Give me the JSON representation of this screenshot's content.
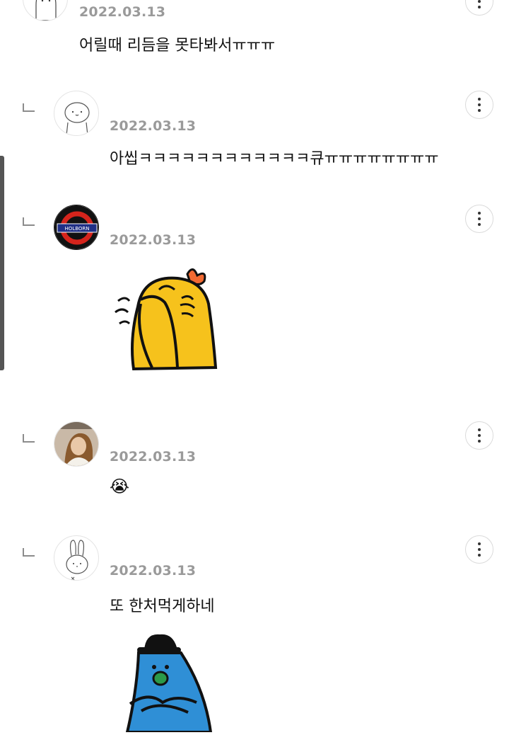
{
  "comments": [
    {
      "date": "2022.03.13",
      "text": "어릴때 리듬을 못타봐서ㅠㅠㅠ"
    },
    {
      "date": "2022.03.13",
      "text": "아씹ㅋㅋㅋㅋㅋㅋㅋㅋㅋㅋㅋㅋ큐ㅠㅠㅠㅠㅠㅠㅠㅠ"
    },
    {
      "date": "2022.03.13",
      "sticker": "crying-yellow-bird-sticker",
      "avatar_badge": "HOLBORN"
    },
    {
      "date": "2022.03.13",
      "emoji": "😭"
    },
    {
      "date": "2022.03.13",
      "text": "또 한처먹게하네",
      "sticker": "blue-character-bowler-hat-sticker"
    }
  ],
  "icons": {
    "more": "more-vertical-icon",
    "reply": "reply-arrow-icon"
  },
  "colors": {
    "date": "#9a9a9a",
    "text": "#111111",
    "holborn_red": "#d5241c",
    "holborn_blue": "#1f2f86",
    "bird_yellow": "#f6c21c",
    "blue_character": "#2f8fd6"
  }
}
